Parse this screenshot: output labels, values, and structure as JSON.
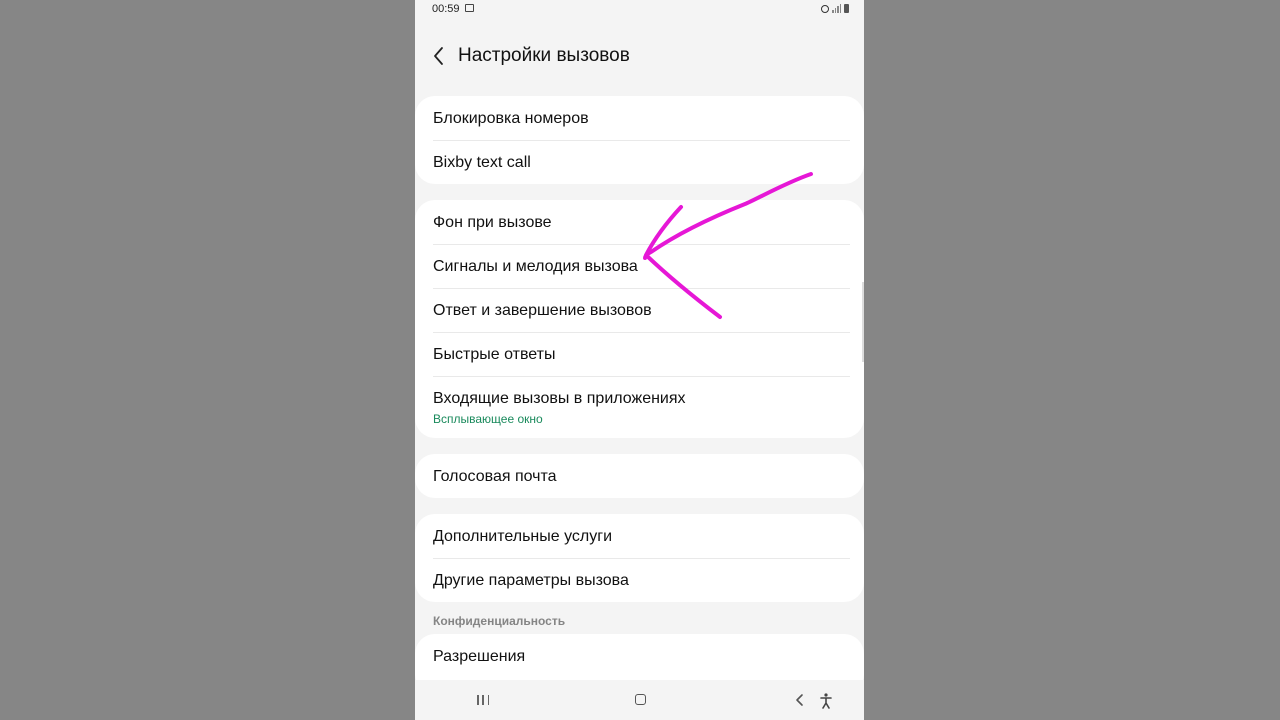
{
  "status_bar": {
    "time": "00:59"
  },
  "header": {
    "title": "Настройки вызовов"
  },
  "groups": [
    {
      "items": [
        {
          "label": "Блокировка номеров"
        },
        {
          "label": "Bixby text call"
        }
      ]
    },
    {
      "items": [
        {
          "label": "Фон при вызове"
        },
        {
          "label": "Сигналы и мелодия вызова"
        },
        {
          "label": "Ответ и завершение вызовов"
        },
        {
          "label": "Быстрые ответы"
        },
        {
          "label": "Входящие вызовы в приложениях",
          "subtext": "Всплывающее окно"
        }
      ]
    },
    {
      "items": [
        {
          "label": "Голосовая почта"
        }
      ]
    },
    {
      "items": [
        {
          "label": "Дополнительные услуги"
        },
        {
          "label": "Другие параметры вызова"
        }
      ]
    }
  ],
  "privacy": {
    "section_title": "Конфиденциальность",
    "items": [
      {
        "label": "Разрешения"
      }
    ]
  },
  "colors": {
    "annotation_arrow": "#e617d6",
    "subtext": "#1a8a5c",
    "card": "#ffffff",
    "background": "#f4f4f4"
  },
  "icons": [
    "back-arrow-icon",
    "alarm-icon",
    "signal-icon",
    "battery-icon",
    "recents-icon",
    "home-icon",
    "nav-back-icon",
    "accessibility-icon"
  ]
}
